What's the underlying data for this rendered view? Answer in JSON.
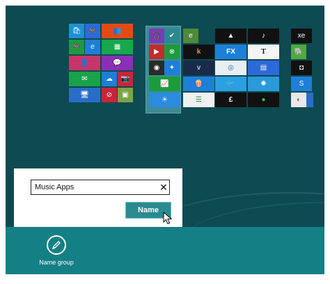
{
  "dialog": {
    "input_value": "Music Apps",
    "clear_glyph": "✕",
    "name_button": "Name"
  },
  "appbar": {
    "name_group_label": "Name group",
    "name_group_icon": "pencil-icon"
  },
  "tile_labels": {
    "store": "🛍",
    "people": "👥",
    "xbox_games": "🎮",
    "ie": "e",
    "calendar": "▦",
    "contacts": "👤",
    "messaging": "💬",
    "mail": "✉",
    "skydrive": "☁",
    "camera": "📷",
    "remote_desktop": "🖥",
    "maps": "⊘",
    "photos": "▣",
    "music": "🎧",
    "checkmark": "✔",
    "video": "▶",
    "xbox": "⊗",
    "podcast": "◉",
    "games2": "✦",
    "finance": "📈",
    "weather": "☀",
    "ie_green": "e",
    "deezer": "▲",
    "guitar": "♪",
    "xe": "xe",
    "kindle": "k",
    "fx": "FX",
    "nyt": "T",
    "evernote": "🐘",
    "vimeo": "v",
    "metro": "◎",
    "news": "▤",
    "camera2": "◘",
    "popcorn": "🍿",
    "tweet": "🐦",
    "nbc": "✺",
    "kayak": "☰",
    "wikipedia": "≡",
    "pound": "£",
    "xbox_green": "●",
    "chrome": "◐",
    "skype": "S"
  },
  "colors": {
    "background": "#0d4a52",
    "appbar": "#157f86",
    "name_button": "#2a8a90"
  }
}
